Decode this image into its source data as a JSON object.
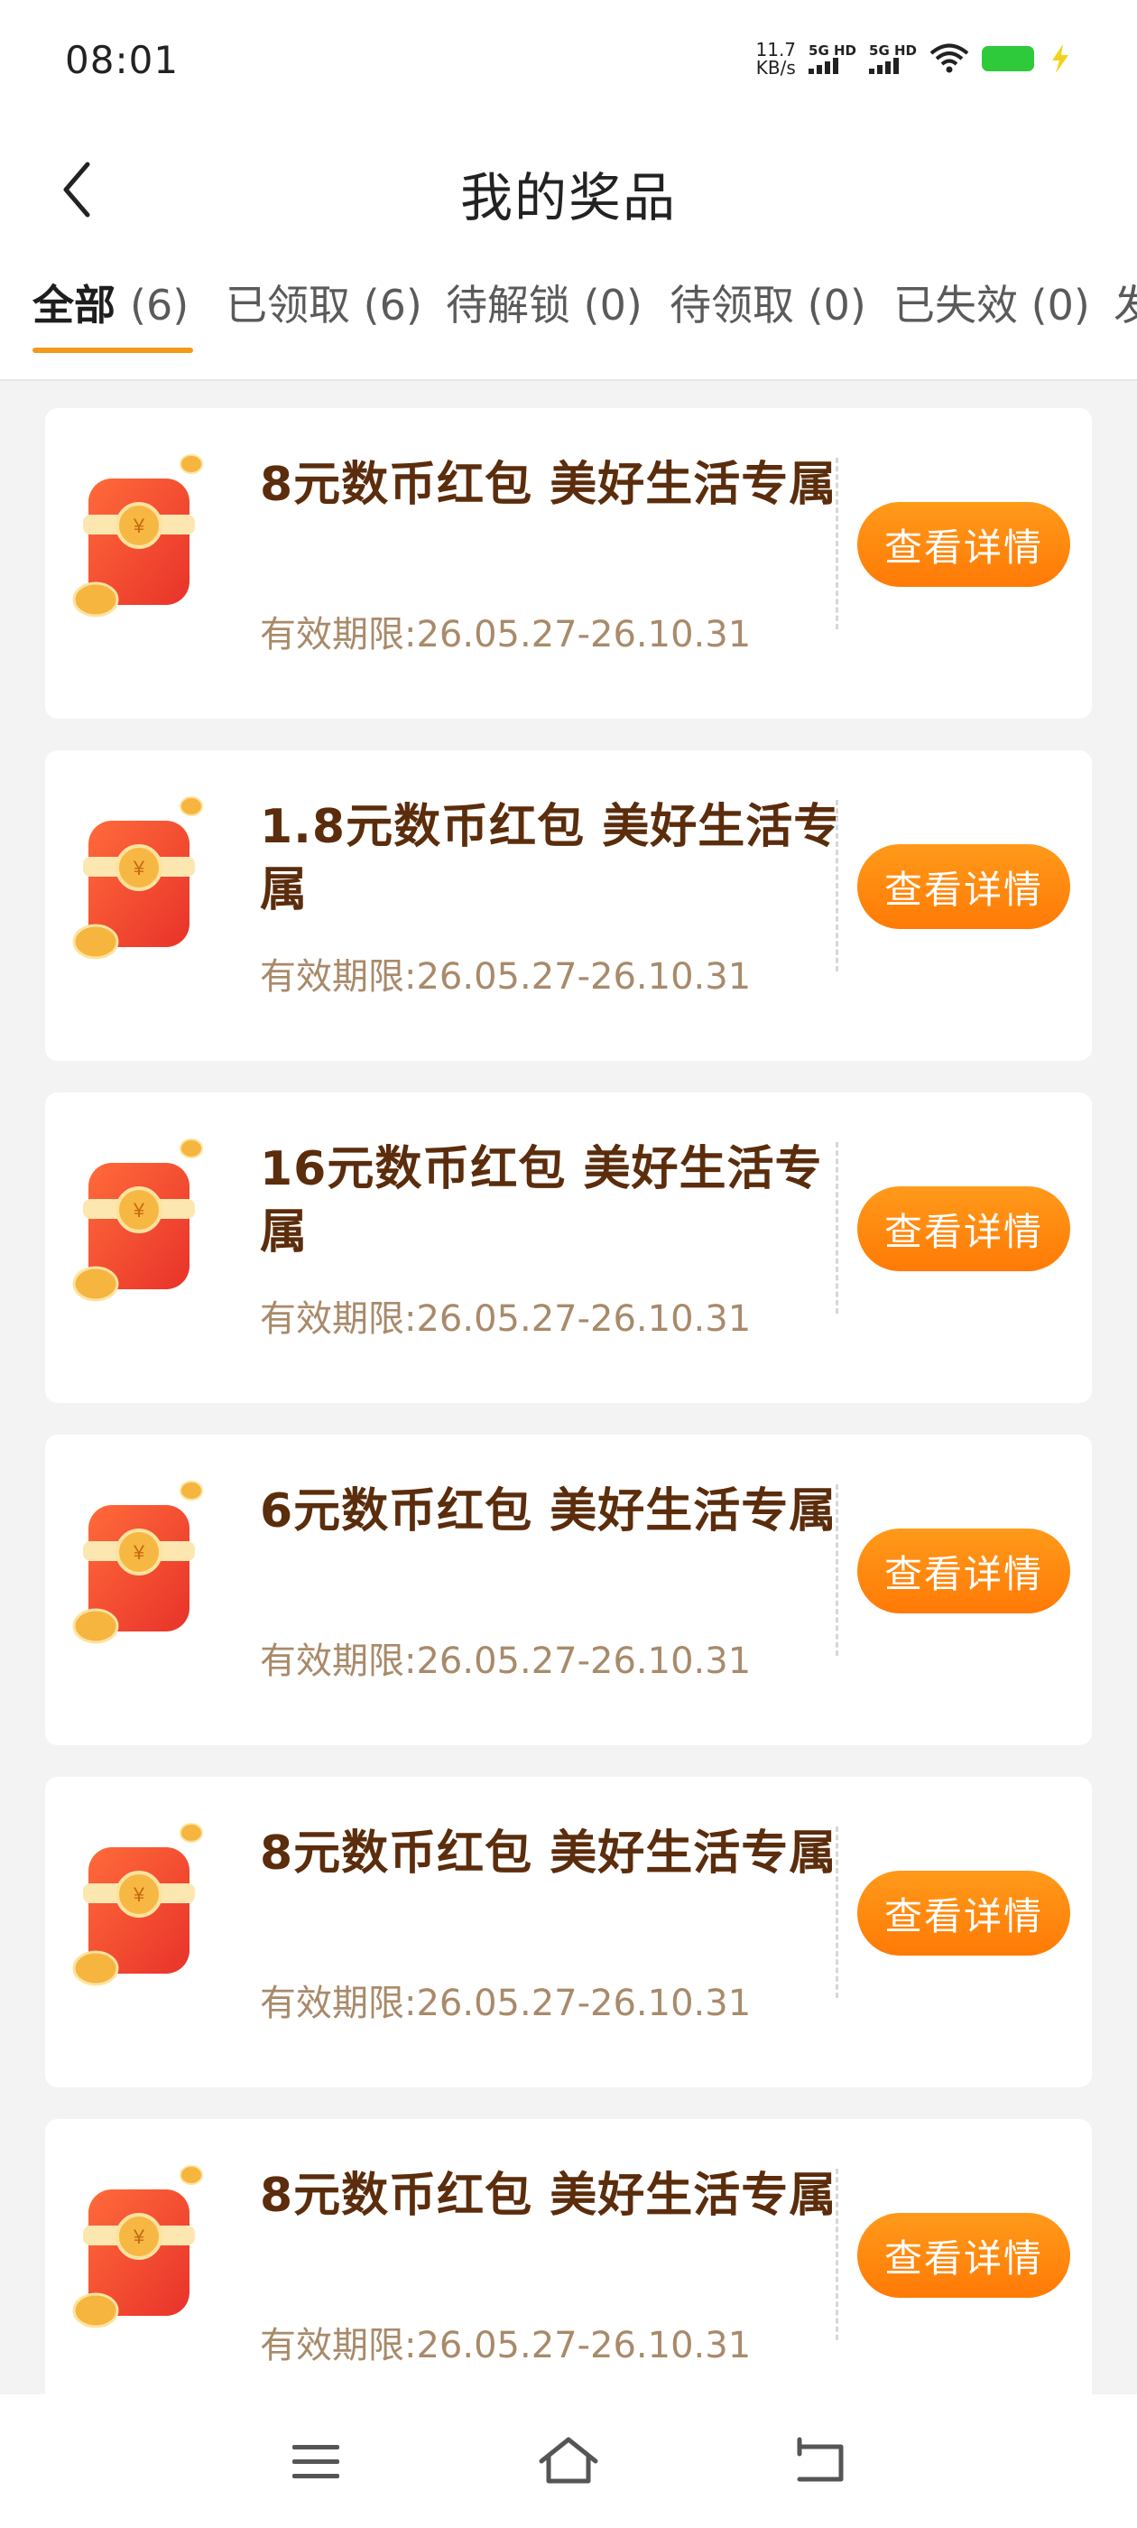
{
  "status_bar": {
    "time": "08:01",
    "net_speed_value": "11.7",
    "net_speed_unit": "KB/s",
    "signal_1_label": "5G HD",
    "signal_2_label": "5G HD",
    "battery_color": "#2fc93c"
  },
  "header": {
    "title": "我的奖品"
  },
  "tabs": [
    {
      "label": "全部",
      "count": "(6)",
      "active": true
    },
    {
      "label": "已领取",
      "count": "(6)",
      "active": false
    },
    {
      "label": "待解锁",
      "count": "(0)",
      "active": false
    },
    {
      "label": "待领取",
      "count": "(0)",
      "active": false
    },
    {
      "label": "已失效",
      "count": "(0)",
      "active": false
    },
    {
      "label": "发",
      "count": "",
      "active": false
    }
  ],
  "prizes": [
    {
      "title": "8元数币红包 美好生活专属",
      "validity": "有效期限:26.05.27-26.10.31",
      "button": "查看详情"
    },
    {
      "title": "1.8元数币红包 美好生活专属",
      "validity": "有效期限:26.05.27-26.10.31",
      "button": "查看详情"
    },
    {
      "title": "16元数币红包 美好生活专属",
      "validity": "有效期限:26.05.27-26.10.31",
      "button": "查看详情"
    },
    {
      "title": "6元数币红包 美好生活专属",
      "validity": "有效期限:26.05.27-26.10.31",
      "button": "查看详情"
    },
    {
      "title": "8元数币红包 美好生活专属",
      "validity": "有效期限:26.05.27-26.10.31",
      "button": "查看详情"
    },
    {
      "title": "8元数币红包 美好生活专属",
      "validity": "有效期限:26.05.27-26.10.31",
      "button": "查看详情"
    }
  ],
  "icons": {
    "back": "chevron-left-icon",
    "red_packet": "red-packet-icon",
    "menu": "menu-icon",
    "home": "home-icon",
    "return": "return-icon"
  },
  "colors": {
    "accent": "#f39a1c",
    "button": "#ff8a10",
    "title_text": "#5b2d0c",
    "validity_text": "#a88a6a"
  }
}
